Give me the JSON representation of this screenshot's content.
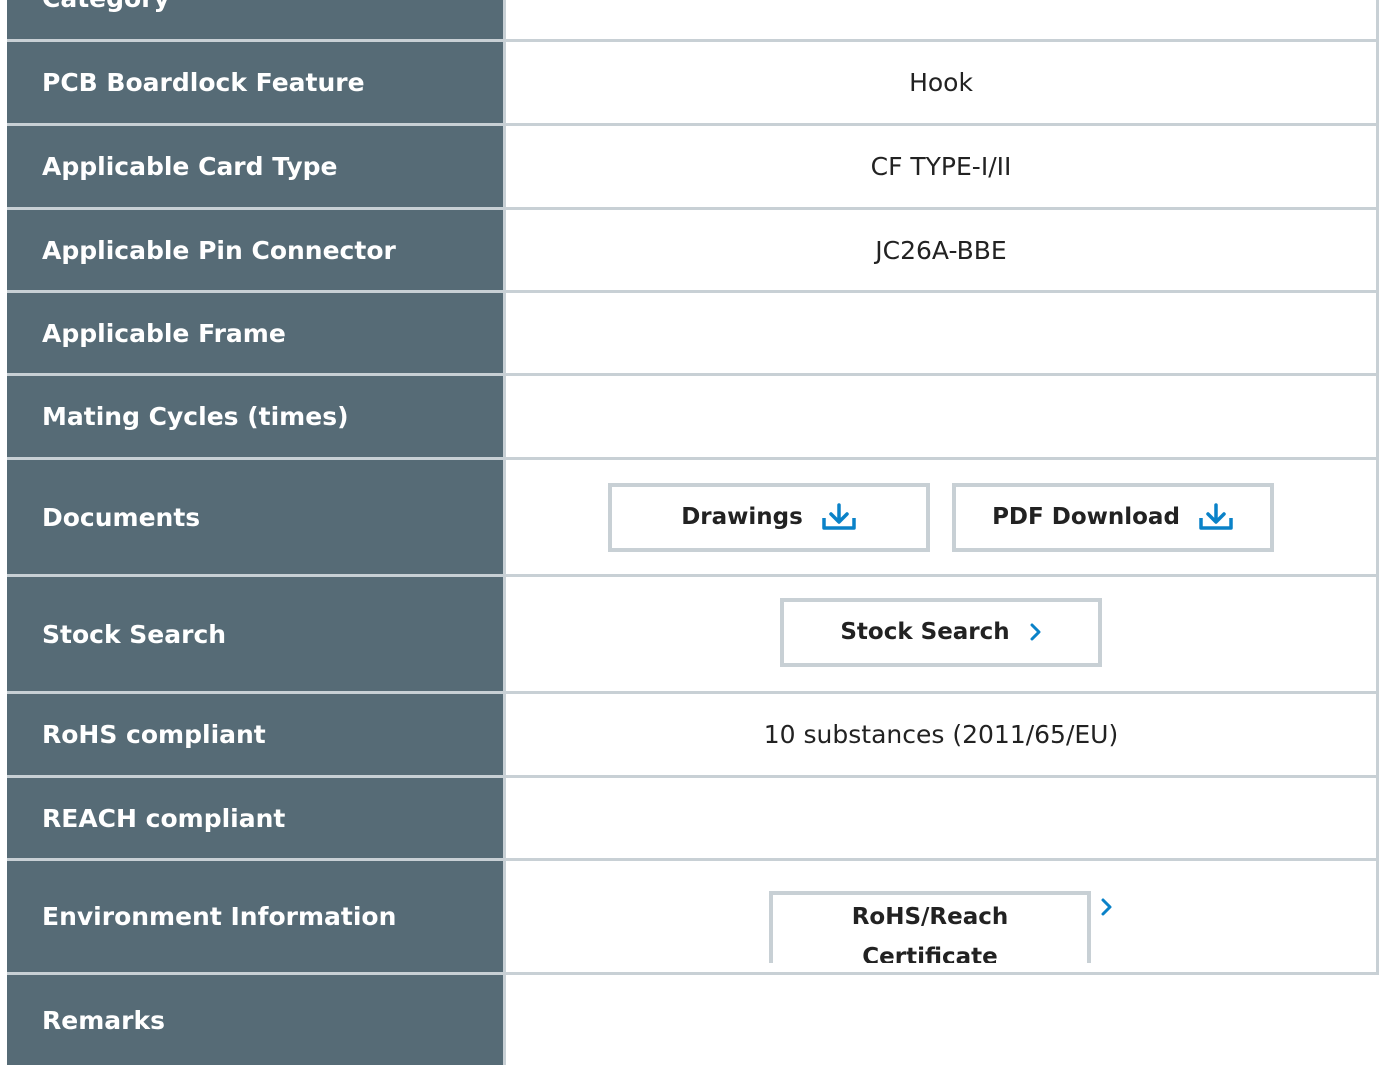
{
  "rows": [
    {
      "label": "Category"
    },
    {
      "label": "PCB Boardlock Feature",
      "value": "Hook"
    },
    {
      "label": "Applicable Card Type",
      "value": "CF TYPE-I/II"
    },
    {
      "label": "Applicable Pin Connector",
      "value": "JC26A-BBE"
    },
    {
      "label": "Applicable Frame",
      "value": ""
    },
    {
      "label": "Mating Cycles (times)",
      "value": ""
    },
    {
      "label": "Documents"
    },
    {
      "label": "Stock Search"
    },
    {
      "label": "RoHS compliant",
      "value": "10 substances (2011/65/EU)"
    },
    {
      "label": "REACH compliant",
      "value": ""
    },
    {
      "label": "Environment Information"
    },
    {
      "label": "Remarks",
      "value": ""
    }
  ],
  "documents": {
    "drawings_label": "Drawings",
    "pdf_label": "PDF Download"
  },
  "stock": {
    "button_label": "Stock Search"
  },
  "environment": {
    "certificate_label_line1": "RoHS/Reach",
    "certificate_label_line2": "Certificate"
  },
  "colors": {
    "label_bg": "#566b76",
    "border": "#c8d0d5",
    "accent": "#0a82c8"
  }
}
